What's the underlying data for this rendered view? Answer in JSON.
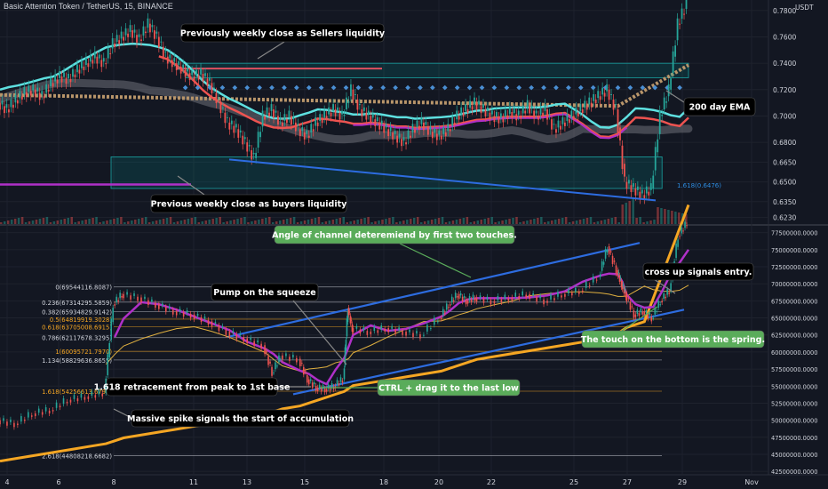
{
  "header": {
    "title": "Basic Attention Token / TetherUS, 15, BINANCE",
    "currency": "USDT"
  },
  "colors": {
    "bg": "#131722",
    "grid": "#1e222d",
    "text": "#d1d4dc",
    "up": "#26a69a",
    "down": "#ef5350",
    "magenta": "#b030c8",
    "orange": "#f5a623",
    "blue": "#2962ff",
    "cyan": "#5ee0e0",
    "green_box": "#5aac5a",
    "fib": "#a08a50"
  },
  "chart_data": [
    {
      "type": "line",
      "name": "price-panel",
      "ylim": [
        0.618,
        0.788
      ],
      "yticks": [
        "0.7800",
        "0.7600",
        "0.7400",
        "0.7200",
        "0.7000",
        "0.6800",
        "0.6650",
        "0.6500",
        "0.6350",
        "0.6230"
      ],
      "yvalues": [
        0.78,
        0.76,
        0.74,
        0.72,
        0.7,
        0.68,
        0.665,
        0.65,
        0.635,
        0.623
      ],
      "price_series": {
        "x": [
          0,
          10,
          20,
          30,
          40,
          50,
          60,
          70,
          80,
          90,
          100,
          110,
          120,
          130,
          140,
          150,
          160,
          170,
          180,
          190,
          200,
          210,
          220,
          230,
          240,
          250,
          260,
          270,
          280,
          290,
          300,
          310,
          320,
          330,
          340,
          350,
          360,
          370,
          380,
          390,
          400,
          410,
          420,
          430,
          440,
          450,
          460,
          470,
          480,
          490,
          500,
          510,
          520,
          530,
          540,
          550,
          560,
          570,
          580,
          590,
          600,
          610,
          620,
          630,
          640,
          650,
          660,
          670,
          680,
          690,
          700,
          710,
          720,
          730,
          740,
          750,
          760,
          770,
          780
        ],
        "y": [
          0.71,
          0.705,
          0.712,
          0.718,
          0.72,
          0.715,
          0.725,
          0.73,
          0.728,
          0.735,
          0.74,
          0.745,
          0.74,
          0.755,
          0.76,
          0.765,
          0.758,
          0.77,
          0.76,
          0.745,
          0.74,
          0.735,
          0.73,
          0.732,
          0.725,
          0.71,
          0.695,
          0.69,
          0.68,
          0.668,
          0.7,
          0.705,
          0.695,
          0.7,
          0.69,
          0.685,
          0.695,
          0.7,
          0.705,
          0.7,
          0.72,
          0.705,
          0.7,
          0.695,
          0.69,
          0.685,
          0.68,
          0.69,
          0.695,
          0.688,
          0.685,
          0.69,
          0.7,
          0.705,
          0.71,
          0.705,
          0.7,
          0.698,
          0.703,
          0.7,
          0.708,
          0.7,
          0.705,
          0.69,
          0.695,
          0.7,
          0.705,
          0.71,
          0.715,
          0.72,
          0.705,
          0.65,
          0.645,
          0.64,
          0.645,
          0.7,
          0.72,
          0.77,
          0.785
        ]
      },
      "lines": {
        "ema200": "200 day EMA",
        "fib_ext": "1.618(0.6476)"
      },
      "annotations": [
        "Previously weekly close as Sellers liquidity",
        "Previous weekly close as buyers liquidity",
        "200 day EMA"
      ]
    },
    {
      "type": "line",
      "name": "oscillator-panel",
      "ylim": [
        42000000,
        78500000
      ],
      "yticks": [
        "77500000.0000",
        "75000000.0000",
        "72500000.0000",
        "70000000.0000",
        "67500000.0000",
        "65000000.0000",
        "62500000.0000",
        "60000000.0000",
        "57500000.0000",
        "55000000.0000",
        "52500000.0000",
        "50000000.0000",
        "47500000.0000",
        "45000000.0000",
        "42500000.0000"
      ],
      "yvalues": [
        77500000,
        75000000,
        72500000,
        70000000,
        67500000,
        65000000,
        62500000,
        60000000,
        57500000,
        55000000,
        52500000,
        50000000,
        47500000,
        45000000,
        42500000
      ],
      "fib_levels": [
        {
          "label": "0(69544116.8087)",
          "value": 69544116.8087,
          "color": "#d1d4dc"
        },
        {
          "label": "0.236(67314295.5859)",
          "value": 67314295.5859,
          "color": "#d1d4dc"
        },
        {
          "label": "0.382(65934829.9142)",
          "value": 65934829.9142,
          "color": "#d1d4dc"
        },
        {
          "label": "0.5(64819919.3028)",
          "value": 64819919.3028,
          "color": "#f5a623"
        },
        {
          "label": "0.618(63705008.6915)",
          "value": 63705008.6915,
          "color": "#f5a623"
        },
        {
          "label": "0.786(62117678.3295)",
          "value": 62117678.3295,
          "color": "#d1d4dc"
        },
        {
          "label": "1(60095721.7970)",
          "value": 60095721.797,
          "color": "#f5a623"
        },
        {
          "label": "1.134(58829636.8655)",
          "value": 58829636.8655,
          "color": "#d1d4dc"
        },
        {
          "label": "1.618(54256613.6798)",
          "value": 54256613.6798,
          "color": "#f5a623"
        },
        {
          "label": "2.618(44808218.6682)",
          "value": 44808218.6682,
          "color": "#d1d4dc"
        }
      ],
      "oscillator_series": {
        "x": [
          0,
          20,
          40,
          60,
          80,
          100,
          120,
          130,
          140,
          160,
          180,
          200,
          220,
          240,
          260,
          280,
          300,
          310,
          320,
          340,
          350,
          360,
          370,
          380,
          390,
          395,
          400,
          420,
          440,
          460,
          480,
          500,
          510,
          520,
          530,
          540,
          560,
          580,
          600,
          620,
          640,
          660,
          680,
          690,
          700,
          705,
          710,
          720,
          730,
          740,
          750,
          760,
          770,
          780
        ],
        "y": [
          50000000,
          49500000,
          51000000,
          51500000,
          53000000,
          53500000,
          54000000,
          67000000,
          68500000,
          68000000,
          67000000,
          66000000,
          65500000,
          64500000,
          63000000,
          62000000,
          61000000,
          57000000,
          59500000,
          59000000,
          56000000,
          54800000,
          54600000,
          55000000,
          56000000,
          66500000,
          63500000,
          63000000,
          63500000,
          63000000,
          62500000,
          65000000,
          67000000,
          68500000,
          67500000,
          68000000,
          67500000,
          68000000,
          68500000,
          67500000,
          68500000,
          69000000,
          71000000,
          75500000,
          72000000,
          70000000,
          68500000,
          65500000,
          66000000,
          65000000,
          67500000,
          69000000,
          77000000,
          79000000
        ]
      },
      "annotations": [
        "Angle of channel deteremiend by first two touches.",
        "Pump on the squeeze",
        "cross up signals entry.",
        "The touch on the bottom is the spring.",
        "1.618  retracement from peak to 1st base",
        "CTRL + drag it to the last low",
        "Massive spike signals the start of accumulation"
      ]
    }
  ],
  "x_axis": {
    "ticks": [
      "4",
      "6",
      "8",
      "11",
      "13",
      "15",
      "18",
      "20",
      "22",
      "25",
      "27",
      "29",
      "Nov"
    ],
    "positions": [
      8,
      66,
      128,
      218,
      278,
      343,
      432,
      494,
      553,
      646,
      706,
      768,
      846
    ]
  },
  "notes": {
    "ema_label": "200 day EMA",
    "fib_ext_label": "1.618(0.6476)"
  }
}
